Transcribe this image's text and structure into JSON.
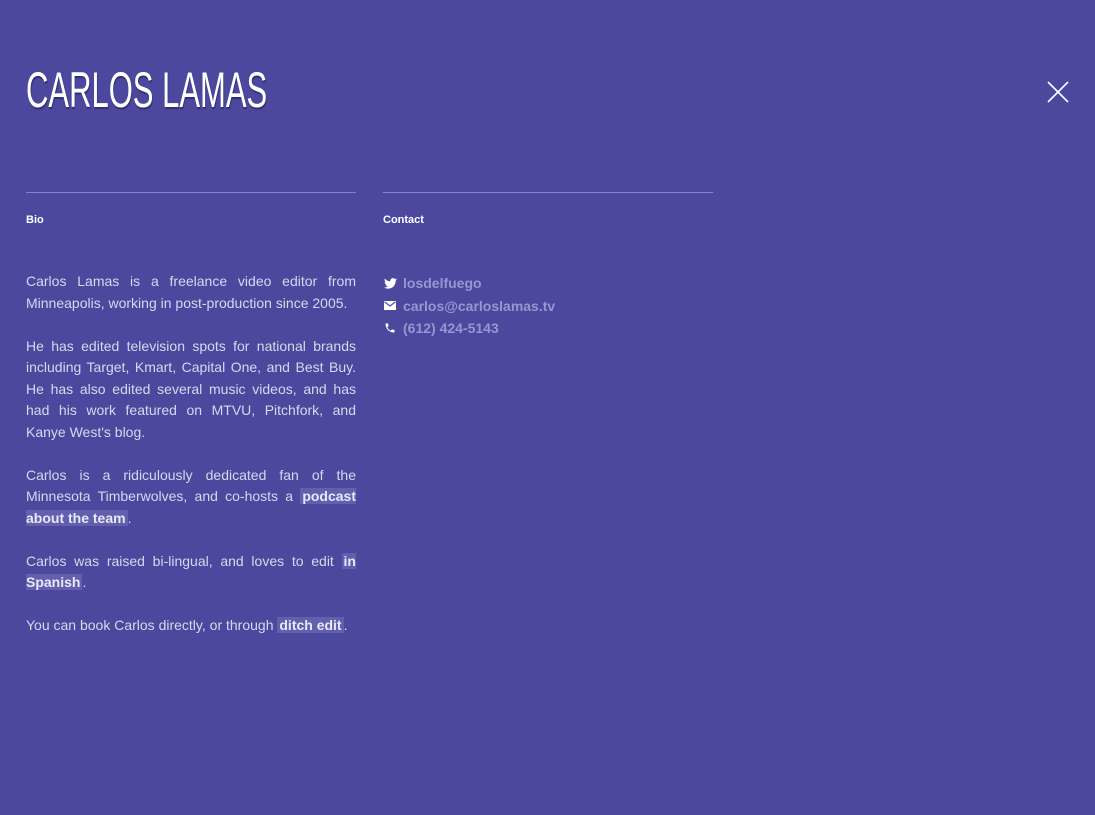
{
  "header": {
    "title": "CARLOS LAMAS"
  },
  "close": {
    "icon": "close-icon"
  },
  "bio": {
    "heading": "Bio",
    "p1": "Carlos Lamas is a freelance video editor from Minneapolis, working in post-production since 2005.",
    "p2": "He has edited television spots for national brands including Target, Kmart, Capital One, and Best Buy. He has also edited several music videos, and has had his work featured on MTVU, Pitchfork, and Kanye West's blog.",
    "p3_before": "Carlos is a ridiculously dedicated fan of the Minnesota Timberwolves, and co-hosts a ",
    "p3_link": "podcast about the team",
    "p3_after": ".",
    "p4_before": "Carlos was raised bi-lingual, and loves to edit ",
    "p4_link": "in Spanish",
    "p4_after": ".",
    "p5_before": "You can book Carlos directly, or through ",
    "p5_link": "ditch edit",
    "p5_after": "."
  },
  "contact": {
    "heading": "Contact",
    "items": [
      {
        "icon": "twitter-icon",
        "text": "losdelfuego"
      },
      {
        "icon": "mail-icon",
        "text": "carlos@carloslamas.tv"
      },
      {
        "icon": "phone-icon",
        "text": "(612) 424-5143"
      }
    ]
  },
  "colors": {
    "background": "#4b489d",
    "text": "#d8d7ee",
    "heading": "#ffffff",
    "link_highlight": "#625fae",
    "contact_text": "#9896d0",
    "divider": "#8583c6"
  }
}
